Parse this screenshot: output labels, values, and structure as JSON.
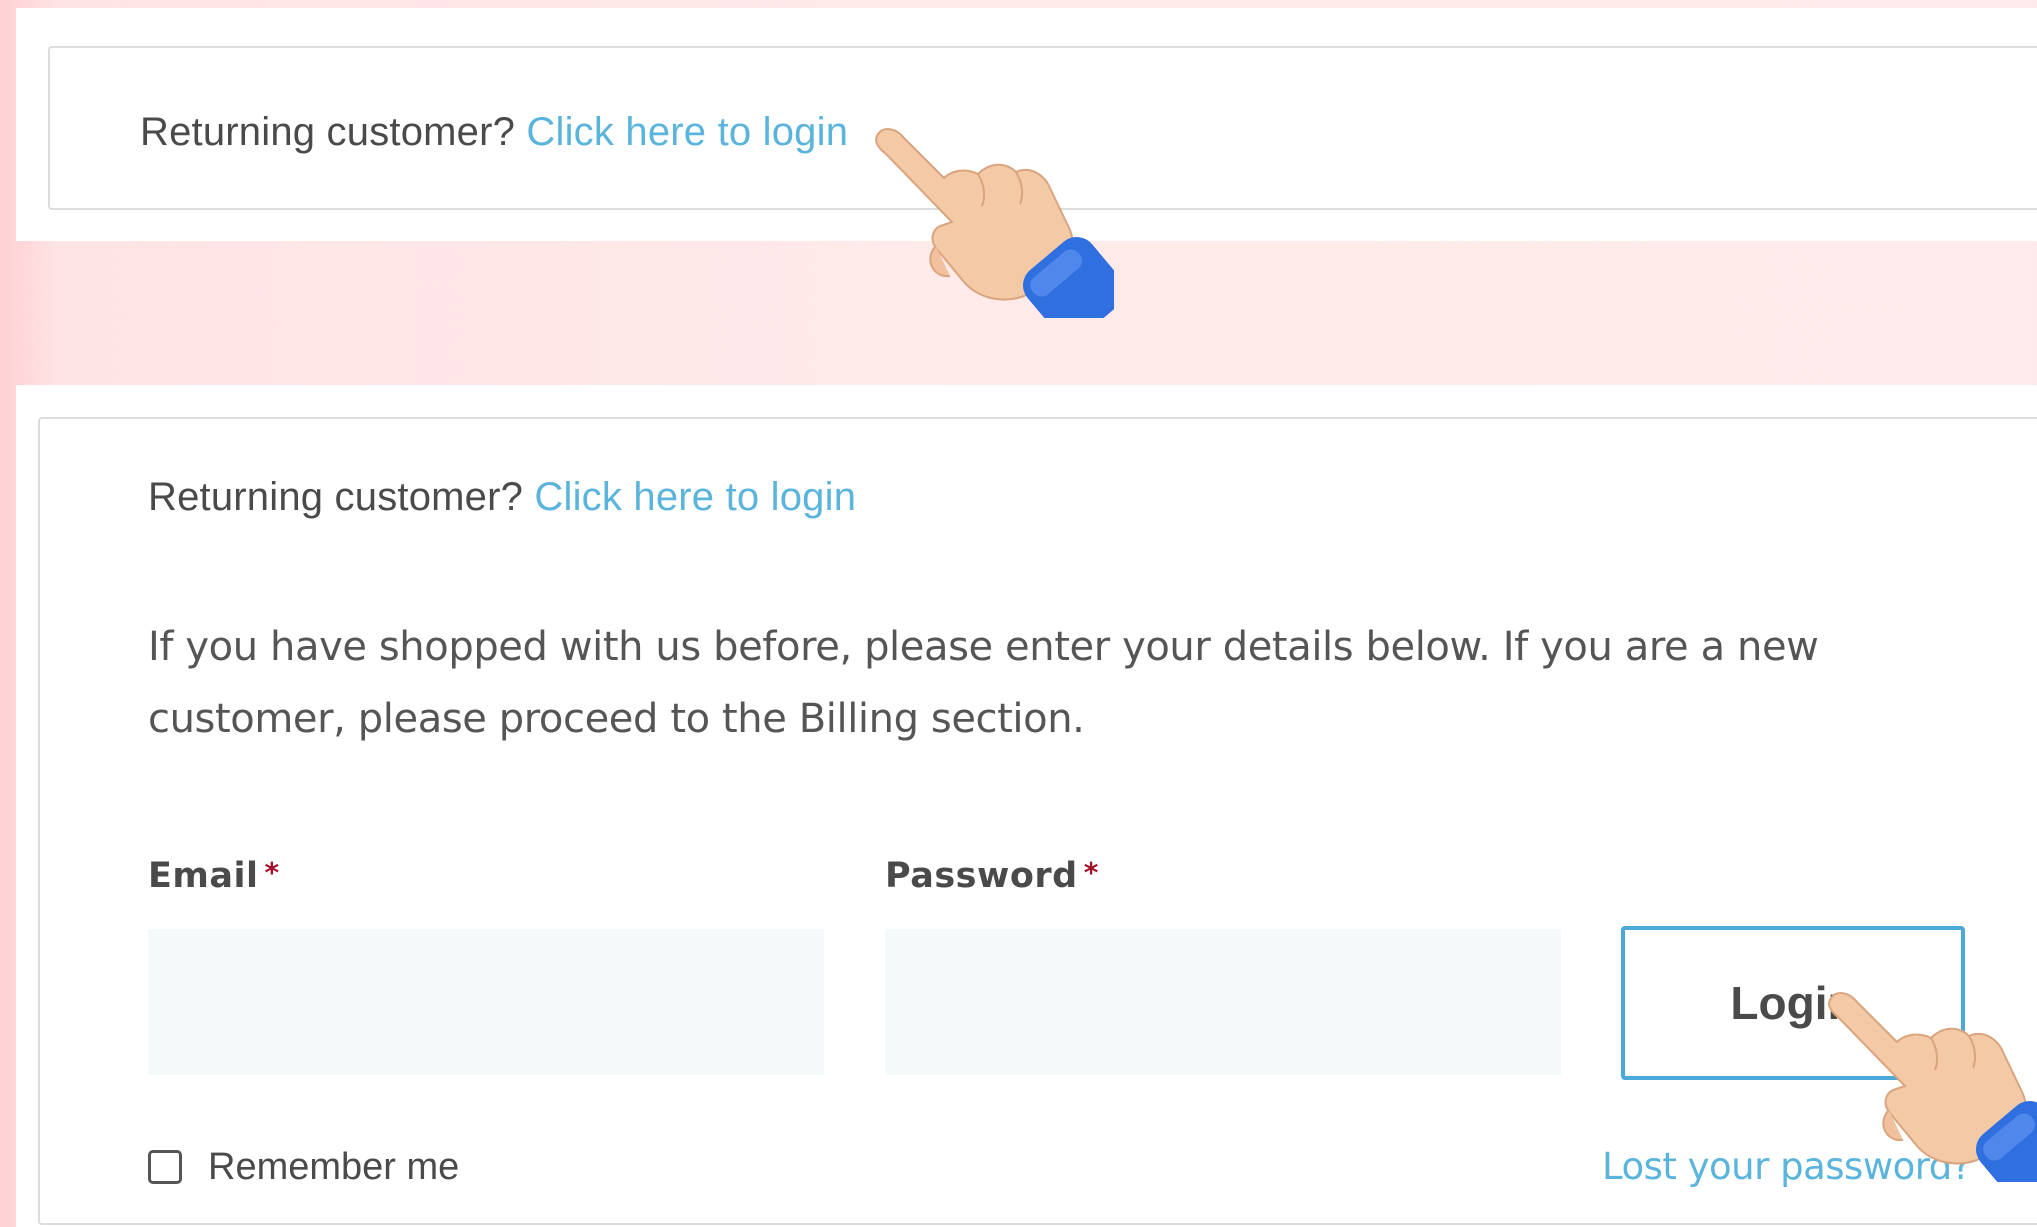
{
  "top_notice": {
    "prefix": "Returning customer?",
    "link": "Click here to login"
  },
  "login_form": {
    "notice_prefix": "Returning customer?",
    "notice_link": "Click here to login",
    "intro": "If you have shopped with us before, please enter your details below. If you are a new customer, please proceed to the Billing section.",
    "email_label": "Email",
    "password_label": "Password",
    "required_marker": "*",
    "email_value": "",
    "password_value": "",
    "login_button": "Login",
    "remember_label": "Remember me",
    "remember_checked": false,
    "lost_password": "Lost your password?"
  },
  "colors": {
    "link": "#5ab4dc",
    "button_border": "#4aa9d6",
    "required": "#a3122a",
    "input_background": "#f4f9f9",
    "page_background": "#ffeaea"
  },
  "icons": [
    "pointing-hand-icon",
    "pointing-hand-icon"
  ]
}
